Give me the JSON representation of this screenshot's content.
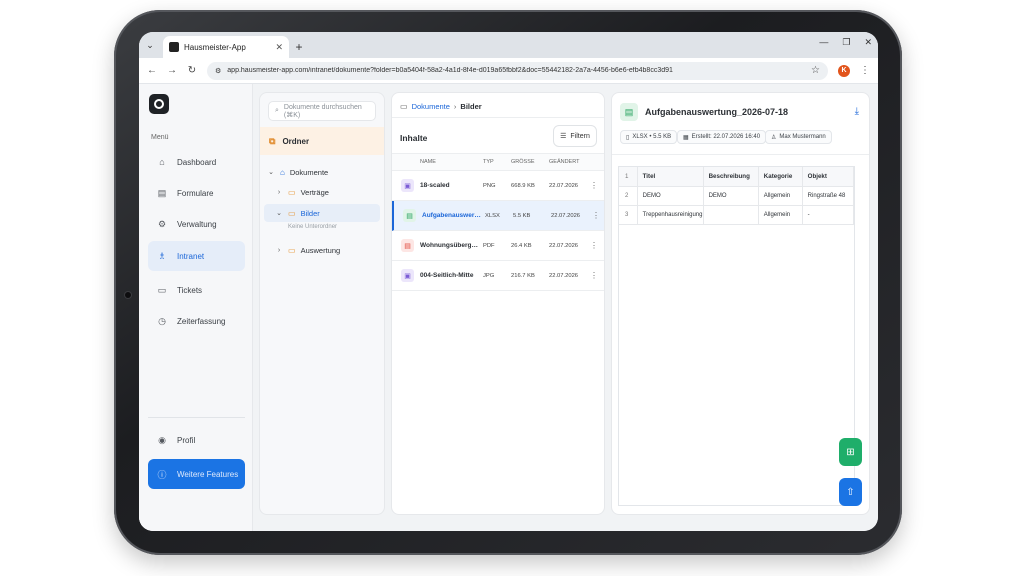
{
  "browser": {
    "tab_title": "Hausmeister-App",
    "url": "app.hausmeister-app.com/intranet/dokumente?folder=b0a5404f-58a2-4a1d-8f4e-d019a65fbbf2&doc=55442182-2a7a-4456-b6e6-efb4b8cc3d91",
    "profile_initial": "K"
  },
  "sidebar": {
    "menu_label": "Menü",
    "items": [
      {
        "label": "Dashboard",
        "icon": "home-icon"
      },
      {
        "label": "Formulare",
        "icon": "clipboard-icon"
      },
      {
        "label": "Verwaltung",
        "icon": "gear-icon"
      },
      {
        "label": "Intranet",
        "icon": "intranet-icon",
        "active": true
      },
      {
        "label": "Tickets",
        "icon": "ticket-icon"
      },
      {
        "label": "Zeiterfassung",
        "icon": "stopwatch-icon"
      }
    ],
    "profile_label": "Profil",
    "features_label": "Weitere Features"
  },
  "folders": {
    "search_placeholder": "Dokumente durchsuchen (⌘K)",
    "header": "Ordner",
    "tree": [
      {
        "label": "Dokumente",
        "level": 0,
        "expanded": true
      },
      {
        "label": "Verträge",
        "level": 1,
        "expanded": false
      },
      {
        "label": "Bilder",
        "level": 1,
        "expanded": true,
        "selected": true
      },
      {
        "label": "Auswertung",
        "level": 1,
        "expanded": false
      }
    ],
    "empty_label": "Keine Unterordner"
  },
  "content": {
    "breadcrumb": {
      "root": "Dokumente",
      "separator": "›",
      "current": "Bilder"
    },
    "heading": "Inhalte",
    "filter_label": "Filtern",
    "columns": {
      "name": "NAME",
      "type": "TYP",
      "size": "GRÖSSE",
      "date": "GEÄNDERT"
    },
    "files": [
      {
        "name": "18-scaled",
        "type": "PNG",
        "size": "668.9 KB",
        "date": "22.07.2026",
        "kind": "img"
      },
      {
        "name": "Aufgabenauswertung_2026-07-18",
        "type": "XLSX",
        "size": "5.5 KB",
        "date": "22.07.2026",
        "kind": "xls",
        "selected": true
      },
      {
        "name": "Wohnungsübergabe",
        "type": "PDF",
        "size": "26.4 KB",
        "date": "22.07.2026",
        "kind": "pdf"
      },
      {
        "name": "004-Seitlich-Mitte",
        "type": "JPG",
        "size": "216.7 KB",
        "date": "22.07.2026",
        "kind": "img"
      }
    ]
  },
  "preview": {
    "title": "Aufgabenauswertung_2026-07-18",
    "meta": {
      "format": "XLSX • 5.5 KB",
      "created": "Erstellt: 22.07.2026 16:40",
      "author": "Max Mustermann"
    },
    "sheet": {
      "headers": [
        "1",
        "Titel",
        "Beschreibung",
        "Kategorie",
        "Objekt"
      ],
      "rows": [
        [
          "2",
          "DEMO",
          "DEMO",
          "Allgemein",
          "Ringstraße 48"
        ],
        [
          "3",
          "Treppenhausreinigung",
          "",
          "Allgemein",
          "-"
        ]
      ]
    }
  }
}
